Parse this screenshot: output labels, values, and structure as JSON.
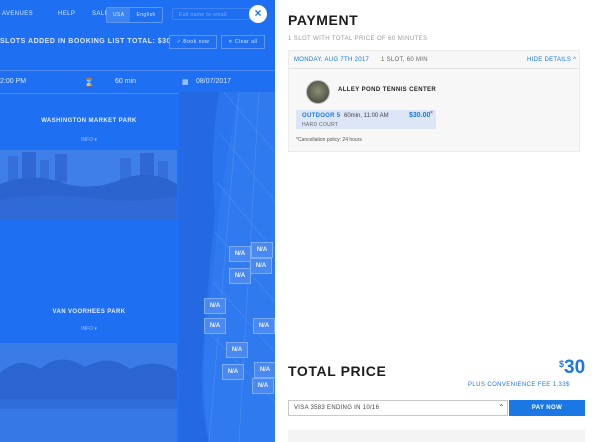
{
  "left": {
    "nav": {
      "avenues": "AVENUES",
      "help": "HELP",
      "sales": "SALES",
      "lang_usa": "USA",
      "lang_english": "English",
      "email_placeholder": "Full name to email"
    },
    "close_icon": "×",
    "slots_text": "SLOTS ADDED IN BOOKING LIST TOTAL: $30",
    "book_now": "✓ Book now",
    "clear_all": "✕ Clear all",
    "filters": {
      "time": "2:00 PM",
      "hourglass_icon": "⌛",
      "duration": "60 min",
      "calendar_icon": "▦",
      "date": "08/07/2017"
    },
    "venues": [
      {
        "name": "WASHINGTON MARKET PARK",
        "info": "INFO ▾"
      },
      {
        "name": "VAN VOORHEES PARK",
        "info": "INFO ▾"
      }
    ],
    "map_pin_label": "N/A"
  },
  "payment": {
    "title": "PAYMENT",
    "subtitle": "1 SLOT WITH TOTAL PRICE OF 60 MINUTES",
    "booking": {
      "date": "MONDAY, AUG 7TH 2017",
      "slots_summary": "1 SLOT, 60 MIN",
      "hide_details": "HIDE DETAILS ^",
      "venue": "ALLEY POND TENNIS CENTER",
      "court": "OUTDOOR 5",
      "time": "60min, 11:00 AM",
      "price": "$30.00",
      "remove": "×",
      "surface": "HARD COURT",
      "cancellation": "*Cancellation policy: 24 hours"
    },
    "total_label": "TOTAL PRICE",
    "total_currency": "$",
    "total_value": "30",
    "convenience_fee": "PLUS CONVENIENCE FEE 1.33$",
    "card_select": "VISA 3583 ENDING IN 10/16",
    "chevron": "⌃",
    "pay_now": "PAY NOW"
  },
  "colors": {
    "overlay_blue": "#1e6ff1",
    "accent": "#1a78e5"
  }
}
